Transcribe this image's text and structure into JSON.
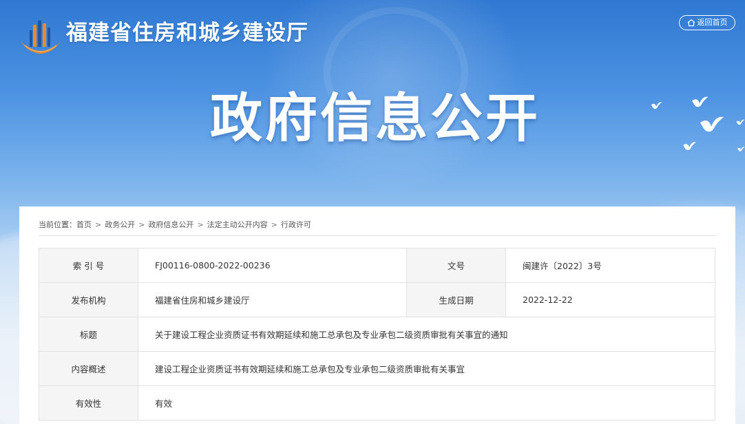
{
  "header": {
    "site_title": "福建省住房和城乡建设厅",
    "home_button": "返回首页",
    "banner_title": "政府信息公开"
  },
  "breadcrumb": {
    "prefix": "当前位置：",
    "items": [
      "首页",
      "政务公开",
      "政府信息公开",
      "法定主动公开内容",
      "行政许可"
    ]
  },
  "info_table": {
    "index_label": "索 引 号",
    "index_value": "FJ00116-0800-2022-00236",
    "docno_label": "文号",
    "docno_value": "闽建许〔2022〕3号",
    "publisher_label": "发布机构",
    "publisher_value": "福建省住房和城乡建设厅",
    "date_label": "生成日期",
    "date_value": "2022-12-22",
    "title_label": "标题",
    "title_value": "关于建设工程企业资质证书有效期延续和施工总承包及专业承包二级资质审批有关事宜的通知",
    "summary_label": "内容概述",
    "summary_value": "建设工程企业资质证书有效期延续和施工总承包及专业承包二级资质审批有关事宜",
    "validity_label": "有效性",
    "validity_value": "有效"
  },
  "colors": {
    "banner_top": "#2f78d2",
    "banner_bottom": "#e9eff7",
    "logo_orange": "#f08a1e",
    "logo_blue": "#1c56a8",
    "label_bg": "#f5f5f5",
    "border": "#e1e1e1"
  },
  "icons": {
    "logo": "bureau-logo-icon",
    "home": "home-icon",
    "doves": "dove-icon"
  }
}
